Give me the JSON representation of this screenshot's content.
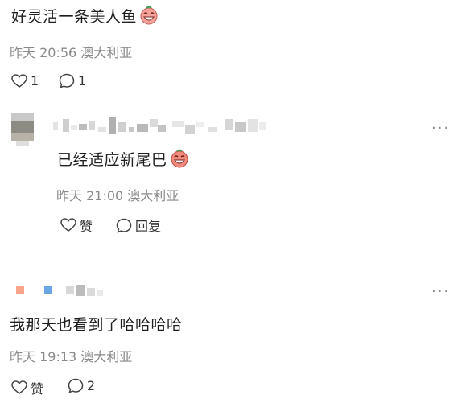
{
  "comment1": {
    "text": "好灵活一条美人鱼",
    "emoji_icon": "laughing-face-icon",
    "meta": "昨天 20:56 澳大利亚",
    "like_count": "1",
    "reply_count": "1"
  },
  "reply1": {
    "text": "已经适应新尾巴",
    "emoji_icon": "laughing-face-icon",
    "meta": "昨天 21:00 澳大利亚",
    "like_label": "赞",
    "reply_label": "回复",
    "more": "···"
  },
  "comment2": {
    "text": "我那天也看到了哈哈哈哈",
    "meta": "昨天 19:13 澳大利亚",
    "like_label": "赞",
    "reply_count": "2",
    "more": "···"
  },
  "colors": {
    "text": "#1f1f1f",
    "meta": "#8a8a8a",
    "icon": "#444444"
  }
}
